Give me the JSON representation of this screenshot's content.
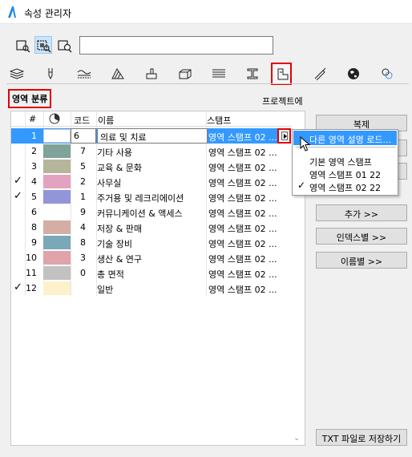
{
  "window": {
    "title": "속성 관리자"
  },
  "toolbar": {
    "buttons": [
      {
        "icon": "plan-view-icon"
      },
      {
        "icon": "selection-view-icon"
      },
      {
        "icon": "find-view-icon"
      }
    ],
    "search": {
      "value": ""
    }
  },
  "tabs": [
    {
      "icon": "layers-icon"
    },
    {
      "icon": "pen-icon"
    },
    {
      "icon": "line-type-icon"
    },
    {
      "icon": "fill-icon"
    },
    {
      "icon": "surface-icon"
    },
    {
      "icon": "composite-icon"
    },
    {
      "icon": "profile-icon"
    },
    {
      "icon": "i-beam-icon"
    },
    {
      "icon": "zone-stamp-icon",
      "active": true
    },
    {
      "icon": "material-icon"
    },
    {
      "icon": "globe-icon"
    },
    {
      "icon": "building-material-icon"
    }
  ],
  "section": {
    "title": "영역 분류",
    "project_label": "프로젝트에"
  },
  "table": {
    "headers": {
      "num": "#",
      "color_icon": "color-wheel-icon",
      "code": "코드",
      "name": "이름",
      "stamp": "스탬프"
    },
    "rows": [
      {
        "checked": false,
        "num": "1",
        "color": "#ffffff",
        "code": "6",
        "name": "의료 및 치료",
        "stamp": "영역 스탬프 02 ...",
        "selected": true
      },
      {
        "checked": false,
        "num": "2",
        "color": "#7fa39a",
        "code": "7",
        "name": "기타 사용",
        "stamp": "영역 스탬프 02 ..."
      },
      {
        "checked": false,
        "num": "3",
        "color": "#b5b59a",
        "code": "5",
        "name": "교육 & 문화",
        "stamp": "영역 스탬프 02 ..."
      },
      {
        "checked": true,
        "num": "4",
        "color": "#e3a3be",
        "code": "2",
        "name": "사무실",
        "stamp": "영역 스탬프 02 ..."
      },
      {
        "checked": true,
        "num": "5",
        "color": "#9395d9",
        "code": "1",
        "name": "주거용 및 레크리에이션",
        "stamp": "영역 스탬프 02 ..."
      },
      {
        "checked": false,
        "num": "6",
        "color": "#ffffff",
        "code": "9",
        "name": "커뮤니케이션 & 액세스",
        "stamp": "영역 스탬프 02 ..."
      },
      {
        "checked": false,
        "num": "8",
        "color": "#d4aea5",
        "code": "4",
        "name": "저장 & 판매",
        "stamp": "영역 스탬프 02 ..."
      },
      {
        "checked": false,
        "num": "9",
        "color": "#7aa8b8",
        "code": "8",
        "name": "기술 장비",
        "stamp": "영역 스탬프 02 ..."
      },
      {
        "checked": false,
        "num": "10",
        "color": "#e0a3a9",
        "code": "3",
        "name": "생산 & 연구",
        "stamp": "영역 스탬프 02 ..."
      },
      {
        "checked": false,
        "num": "11",
        "color": "#c2c2c2",
        "code": "0",
        "name": "총 면적",
        "stamp": "영역 스탬프 02 ..."
      },
      {
        "checked": true,
        "num": "12",
        "color": "#fdf1cc",
        "code": "",
        "name": "일반",
        "stamp": "영역 스탬프 02 ..."
      }
    ]
  },
  "buttons": {
    "duplicate": "복제",
    "add": "추가 >>",
    "by_index": "인덱스별 >>",
    "by_name": "이름별 >>",
    "save_txt": "TXT 파일로 저장하기"
  },
  "popup": {
    "load_label": "다른 영역 설명 로드...",
    "options": [
      {
        "label": "기본 영역 스탬프",
        "checked": false
      },
      {
        "label": "영역 스탬프 01 22",
        "checked": false
      },
      {
        "label": "영역 스탬프 02 22",
        "checked": true
      }
    ]
  },
  "colors": {
    "selection": "#3399ff",
    "highlight_box": "#e00000"
  }
}
